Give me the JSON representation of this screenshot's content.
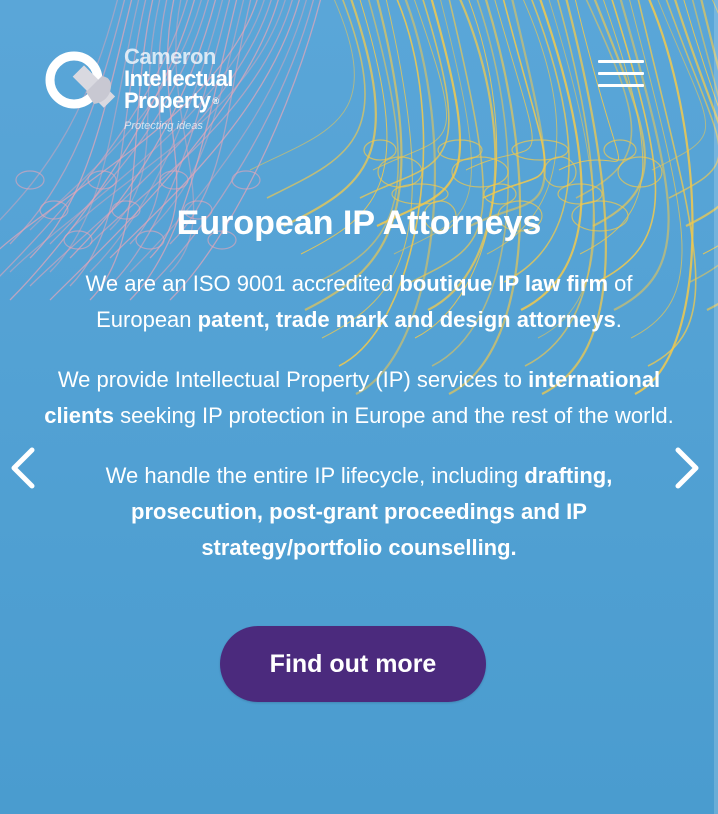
{
  "brand": {
    "name_line1": "Cameron",
    "name_line2": "Intellectual",
    "name_line3": "Property",
    "registered": "®",
    "tagline": "Protecting ideas"
  },
  "icons": {
    "menu": "hamburger-menu-icon",
    "prev": "chevron-left-icon",
    "next": "chevron-right-icon",
    "logo": "cip-logo-mark"
  },
  "colors": {
    "background": "#4a9ccf",
    "cta": "#4b2a7d",
    "text": "#ffffff",
    "fiber_yellow": "#f2c94c",
    "fiber_pink": "#e9a6b8"
  },
  "slide": {
    "heading": "European IP Attorneys",
    "p1": {
      "a": "We are an ISO 9001 accredited ",
      "b": "boutique IP law firm",
      "c": " of European ",
      "d": "patent, trade mark and design attorneys",
      "e": "."
    },
    "p2": {
      "a": "We provide Intellectual Property (IP) services to ",
      "b": "international clients",
      "c": " seeking IP protection in Europe and the rest of the world."
    },
    "p3": {
      "a": "We handle the entire IP lifecycle, including ",
      "b": "drafting, prosecution, post-grant proceedings and IP strategy/portfolio counselling."
    },
    "cta_label": "Find out more"
  }
}
